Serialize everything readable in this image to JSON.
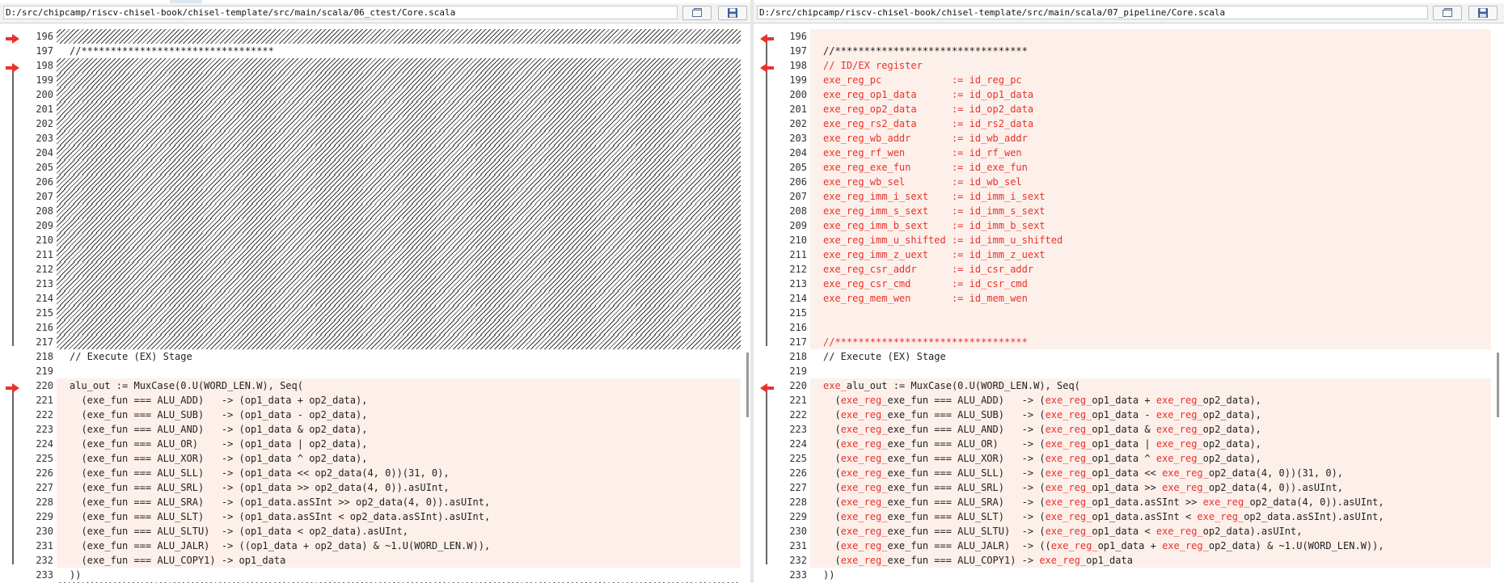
{
  "left": {
    "path": "D:/src/chipcamp/riscv-chisel-book/chisel-template/src/main/scala/06_ctest/Core.scala",
    "lines": [
      {
        "num": "196",
        "text": "",
        "state": "hatch",
        "marker": true
      },
      {
        "num": "197",
        "text": "//*********************************",
        "state": "plain",
        "marker": false
      },
      {
        "num": "198",
        "text": "",
        "state": "hatch",
        "marker": true
      },
      {
        "num": "199",
        "text": "",
        "state": "hatch",
        "marker": false
      },
      {
        "num": "200",
        "text": "",
        "state": "hatch",
        "marker": false
      },
      {
        "num": "201",
        "text": "",
        "state": "hatch",
        "marker": false
      },
      {
        "num": "202",
        "text": "",
        "state": "hatch",
        "marker": false
      },
      {
        "num": "203",
        "text": "",
        "state": "hatch",
        "marker": false
      },
      {
        "num": "204",
        "text": "",
        "state": "hatch",
        "marker": false
      },
      {
        "num": "205",
        "text": "",
        "state": "hatch",
        "marker": false
      },
      {
        "num": "206",
        "text": "",
        "state": "hatch",
        "marker": false
      },
      {
        "num": "207",
        "text": "",
        "state": "hatch",
        "marker": false
      },
      {
        "num": "208",
        "text": "",
        "state": "hatch",
        "marker": false
      },
      {
        "num": "209",
        "text": "",
        "state": "hatch",
        "marker": false
      },
      {
        "num": "210",
        "text": "",
        "state": "hatch",
        "marker": false
      },
      {
        "num": "211",
        "text": "",
        "state": "hatch",
        "marker": false
      },
      {
        "num": "212",
        "text": "",
        "state": "hatch",
        "marker": false
      },
      {
        "num": "213",
        "text": "",
        "state": "hatch",
        "marker": false
      },
      {
        "num": "214",
        "text": "",
        "state": "hatch",
        "marker": false
      },
      {
        "num": "215",
        "text": "",
        "state": "hatch",
        "marker": false
      },
      {
        "num": "216",
        "text": "",
        "state": "hatch",
        "marker": false
      },
      {
        "num": "217",
        "text": "",
        "state": "hatch",
        "marker": false
      },
      {
        "num": "218",
        "text": "// Execute (EX) Stage",
        "state": "plain",
        "marker": false
      },
      {
        "num": "219",
        "text": "",
        "state": "plain",
        "marker": false
      },
      {
        "num": "220",
        "text": "alu_out := MuxCase(0.U(WORD_LEN.W), Seq(",
        "state": "changed",
        "marker": true
      },
      {
        "num": "221",
        "text": "  (exe_fun === ALU_ADD)   -> (op1_data + op2_data),",
        "state": "changed",
        "marker": false
      },
      {
        "num": "222",
        "text": "  (exe_fun === ALU_SUB)   -> (op1_data - op2_data),",
        "state": "changed",
        "marker": false
      },
      {
        "num": "223",
        "text": "  (exe_fun === ALU_AND)   -> (op1_data & op2_data),",
        "state": "changed",
        "marker": false
      },
      {
        "num": "224",
        "text": "  (exe_fun === ALU_OR)    -> (op1_data | op2_data),",
        "state": "changed",
        "marker": false
      },
      {
        "num": "225",
        "text": "  (exe_fun === ALU_XOR)   -> (op1_data ^ op2_data),",
        "state": "changed",
        "marker": false
      },
      {
        "num": "226",
        "text": "  (exe_fun === ALU_SLL)   -> (op1_data << op2_data(4, 0))(31, 0),",
        "state": "changed",
        "marker": false
      },
      {
        "num": "227",
        "text": "  (exe_fun === ALU_SRL)   -> (op1_data >> op2_data(4, 0)).asUInt,",
        "state": "changed",
        "marker": false
      },
      {
        "num": "228",
        "text": "  (exe_fun === ALU_SRA)   -> (op1_data.asSInt >> op2_data(4, 0)).asUInt,",
        "state": "changed",
        "marker": false
      },
      {
        "num": "229",
        "text": "  (exe_fun === ALU_SLT)   -> (op1_data.asSInt < op2_data.asSInt).asUInt,",
        "state": "changed",
        "marker": false
      },
      {
        "num": "230",
        "text": "  (exe_fun === ALU_SLTU)  -> (op1_data < op2_data).asUInt,",
        "state": "changed",
        "marker": false
      },
      {
        "num": "231",
        "text": "  (exe_fun === ALU_JALR)  -> ((op1_data + op2_data) & ~1.U(WORD_LEN.W)),",
        "state": "changed",
        "marker": false
      },
      {
        "num": "232",
        "text": "  (exe_fun === ALU_COPY1) -> op1_data",
        "state": "changed",
        "marker": false
      },
      {
        "num": "233",
        "text": "))",
        "state": "plain",
        "marker": false
      }
    ]
  },
  "right": {
    "path": "D:/src/chipcamp/riscv-chisel-book/chisel-template/src/main/scala/07_pipeline/Core.scala",
    "lines": [
      {
        "num": "196",
        "marker": true,
        "state": "changed",
        "segs": []
      },
      {
        "num": "197",
        "marker": false,
        "state": "changed",
        "segs": [
          {
            "t": "//*********************************",
            "r": false
          }
        ]
      },
      {
        "num": "198",
        "marker": true,
        "state": "changed",
        "segs": [
          {
            "t": "// ID/EX register",
            "r": true
          }
        ]
      },
      {
        "num": "199",
        "marker": false,
        "state": "changed",
        "segs": [
          {
            "t": "exe_reg_pc            := id_reg_pc",
            "r": true
          }
        ]
      },
      {
        "num": "200",
        "marker": false,
        "state": "changed",
        "segs": [
          {
            "t": "exe_reg_op1_data      := id_op1_data",
            "r": true
          }
        ]
      },
      {
        "num": "201",
        "marker": false,
        "state": "changed",
        "segs": [
          {
            "t": "exe_reg_op2_data      := id_op2_data",
            "r": true
          }
        ]
      },
      {
        "num": "202",
        "marker": false,
        "state": "changed",
        "segs": [
          {
            "t": "exe_reg_rs2_data      := id_rs2_data",
            "r": true
          }
        ]
      },
      {
        "num": "203",
        "marker": false,
        "state": "changed",
        "segs": [
          {
            "t": "exe_reg_wb_addr       := id_wb_addr",
            "r": true
          }
        ]
      },
      {
        "num": "204",
        "marker": false,
        "state": "changed",
        "segs": [
          {
            "t": "exe_reg_rf_wen        := id_rf_wen",
            "r": true
          }
        ]
      },
      {
        "num": "205",
        "marker": false,
        "state": "changed",
        "segs": [
          {
            "t": "exe_reg_exe_fun       := id_exe_fun",
            "r": true
          }
        ]
      },
      {
        "num": "206",
        "marker": false,
        "state": "changed",
        "segs": [
          {
            "t": "exe_reg_wb_sel        := id_wb_sel",
            "r": true
          }
        ]
      },
      {
        "num": "207",
        "marker": false,
        "state": "changed",
        "segs": [
          {
            "t": "exe_reg_imm_i_sext    := id_imm_i_sext",
            "r": true
          }
        ]
      },
      {
        "num": "208",
        "marker": false,
        "state": "changed",
        "segs": [
          {
            "t": "exe_reg_imm_s_sext    := id_imm_s_sext",
            "r": true
          }
        ]
      },
      {
        "num": "209",
        "marker": false,
        "state": "changed",
        "segs": [
          {
            "t": "exe_reg_imm_b_sext    := id_imm_b_sext",
            "r": true
          }
        ]
      },
      {
        "num": "210",
        "marker": false,
        "state": "changed",
        "segs": [
          {
            "t": "exe_reg_imm_u_shifted := id_imm_u_shifted",
            "r": true
          }
        ]
      },
      {
        "num": "211",
        "marker": false,
        "state": "changed",
        "segs": [
          {
            "t": "exe_reg_imm_z_uext    := id_imm_z_uext",
            "r": true
          }
        ]
      },
      {
        "num": "212",
        "marker": false,
        "state": "changed",
        "segs": [
          {
            "t": "exe_reg_csr_addr      := id_csr_addr",
            "r": true
          }
        ]
      },
      {
        "num": "213",
        "marker": false,
        "state": "changed",
        "segs": [
          {
            "t": "exe_reg_csr_cmd       := id_csr_cmd",
            "r": true
          }
        ]
      },
      {
        "num": "214",
        "marker": false,
        "state": "changed",
        "segs": [
          {
            "t": "exe_reg_mem_wen       := id_mem_wen",
            "r": true
          }
        ]
      },
      {
        "num": "215",
        "marker": false,
        "state": "changed",
        "segs": []
      },
      {
        "num": "216",
        "marker": false,
        "state": "changed",
        "segs": []
      },
      {
        "num": "217",
        "marker": false,
        "state": "changed",
        "segs": [
          {
            "t": "//*********************************",
            "r": true
          }
        ]
      },
      {
        "num": "218",
        "marker": false,
        "state": "plain",
        "segs": [
          {
            "t": "// Execute (EX) Stage",
            "r": false
          }
        ]
      },
      {
        "num": "219",
        "marker": false,
        "state": "plain",
        "segs": []
      },
      {
        "num": "220",
        "marker": true,
        "state": "changed",
        "segs": [
          {
            "t": "exe_",
            "r": true
          },
          {
            "t": "alu_out := MuxCase(0.U(WORD_LEN.W), Seq(",
            "r": false
          }
        ]
      },
      {
        "num": "221",
        "marker": false,
        "state": "changed",
        "segs": [
          {
            "t": "  (",
            "r": false
          },
          {
            "t": "exe_reg_",
            "r": true
          },
          {
            "t": "exe_fun === ALU_ADD)   -> (",
            "r": false
          },
          {
            "t": "exe_reg_",
            "r": true
          },
          {
            "t": "op1_data + ",
            "r": false
          },
          {
            "t": "exe_reg_",
            "r": true
          },
          {
            "t": "op2_data),",
            "r": false
          }
        ]
      },
      {
        "num": "222",
        "marker": false,
        "state": "changed",
        "segs": [
          {
            "t": "  (",
            "r": false
          },
          {
            "t": "exe_reg_",
            "r": true
          },
          {
            "t": "exe_fun === ALU_SUB)   -> (",
            "r": false
          },
          {
            "t": "exe_reg_",
            "r": true
          },
          {
            "t": "op1_data - ",
            "r": false
          },
          {
            "t": "exe_reg_",
            "r": true
          },
          {
            "t": "op2_data),",
            "r": false
          }
        ]
      },
      {
        "num": "223",
        "marker": false,
        "state": "changed",
        "segs": [
          {
            "t": "  (",
            "r": false
          },
          {
            "t": "exe_reg_",
            "r": true
          },
          {
            "t": "exe_fun === ALU_AND)   -> (",
            "r": false
          },
          {
            "t": "exe_reg_",
            "r": true
          },
          {
            "t": "op1_data & ",
            "r": false
          },
          {
            "t": "exe_reg_",
            "r": true
          },
          {
            "t": "op2_data),",
            "r": false
          }
        ]
      },
      {
        "num": "224",
        "marker": false,
        "state": "changed",
        "segs": [
          {
            "t": "  (",
            "r": false
          },
          {
            "t": "exe_reg_",
            "r": true
          },
          {
            "t": "exe_fun === ALU_OR)    -> (",
            "r": false
          },
          {
            "t": "exe_reg_",
            "r": true
          },
          {
            "t": "op1_data | ",
            "r": false
          },
          {
            "t": "exe_reg_",
            "r": true
          },
          {
            "t": "op2_data),",
            "r": false
          }
        ]
      },
      {
        "num": "225",
        "marker": false,
        "state": "changed",
        "segs": [
          {
            "t": "  (",
            "r": false
          },
          {
            "t": "exe_reg_",
            "r": true
          },
          {
            "t": "exe_fun === ALU_XOR)   -> (",
            "r": false
          },
          {
            "t": "exe_reg_",
            "r": true
          },
          {
            "t": "op1_data ^ ",
            "r": false
          },
          {
            "t": "exe_reg_",
            "r": true
          },
          {
            "t": "op2_data),",
            "r": false
          }
        ]
      },
      {
        "num": "226",
        "marker": false,
        "state": "changed",
        "segs": [
          {
            "t": "  (",
            "r": false
          },
          {
            "t": "exe_reg_",
            "r": true
          },
          {
            "t": "exe_fun === ALU_SLL)   -> (",
            "r": false
          },
          {
            "t": "exe_reg_",
            "r": true
          },
          {
            "t": "op1_data << ",
            "r": false
          },
          {
            "t": "exe_reg_",
            "r": true
          },
          {
            "t": "op2_data(4, 0))(31, 0),",
            "r": false
          }
        ]
      },
      {
        "num": "227",
        "marker": false,
        "state": "changed",
        "segs": [
          {
            "t": "  (",
            "r": false
          },
          {
            "t": "exe_reg_",
            "r": true
          },
          {
            "t": "exe_fun === ALU_SRL)   -> (",
            "r": false
          },
          {
            "t": "exe_reg_",
            "r": true
          },
          {
            "t": "op1_data >> ",
            "r": false
          },
          {
            "t": "exe_reg_",
            "r": true
          },
          {
            "t": "op2_data(4, 0)).asUInt,",
            "r": false
          }
        ]
      },
      {
        "num": "228",
        "marker": false,
        "state": "changed",
        "segs": [
          {
            "t": "  (",
            "r": false
          },
          {
            "t": "exe_reg_",
            "r": true
          },
          {
            "t": "exe_fun === ALU_SRA)   -> (",
            "r": false
          },
          {
            "t": "exe_reg_",
            "r": true
          },
          {
            "t": "op1_data.asSInt >> ",
            "r": false
          },
          {
            "t": "exe_reg_",
            "r": true
          },
          {
            "t": "op2_data(4, 0)).asUInt,",
            "r": false
          }
        ]
      },
      {
        "num": "229",
        "marker": false,
        "state": "changed",
        "segs": [
          {
            "t": "  (",
            "r": false
          },
          {
            "t": "exe_reg_",
            "r": true
          },
          {
            "t": "exe_fun === ALU_SLT)   -> (",
            "r": false
          },
          {
            "t": "exe_reg_",
            "r": true
          },
          {
            "t": "op1_data.asSInt < ",
            "r": false
          },
          {
            "t": "exe_reg_",
            "r": true
          },
          {
            "t": "op2_data.asSInt).asUInt,",
            "r": false
          }
        ]
      },
      {
        "num": "230",
        "marker": false,
        "state": "changed",
        "segs": [
          {
            "t": "  (",
            "r": false
          },
          {
            "t": "exe_reg_",
            "r": true
          },
          {
            "t": "exe_fun === ALU_SLTU)  -> (",
            "r": false
          },
          {
            "t": "exe_reg_",
            "r": true
          },
          {
            "t": "op1_data < ",
            "r": false
          },
          {
            "t": "exe_reg_",
            "r": true
          },
          {
            "t": "op2_data).asUInt,",
            "r": false
          }
        ]
      },
      {
        "num": "231",
        "marker": false,
        "state": "changed",
        "segs": [
          {
            "t": "  (",
            "r": false
          },
          {
            "t": "exe_reg_",
            "r": true
          },
          {
            "t": "exe_fun === ALU_JALR)  -> ((",
            "r": false
          },
          {
            "t": "exe_reg_",
            "r": true
          },
          {
            "t": "op1_data + ",
            "r": false
          },
          {
            "t": "exe_reg_",
            "r": true
          },
          {
            "t": "op2_data) & ~1.U(WORD_LEN.W)),",
            "r": false
          }
        ]
      },
      {
        "num": "232",
        "marker": false,
        "state": "changed",
        "segs": [
          {
            "t": "  (",
            "r": false
          },
          {
            "t": "exe_reg_",
            "r": true
          },
          {
            "t": "exe_fun === ALU_COPY1) -> ",
            "r": false
          },
          {
            "t": "exe_reg_",
            "r": true
          },
          {
            "t": "op1_data",
            "r": false
          }
        ]
      },
      {
        "num": "233",
        "marker": false,
        "state": "plain",
        "segs": [
          {
            "t": "))",
            "r": false
          }
        ]
      }
    ]
  },
  "icons": {
    "copy_path": "copy-icon",
    "save": "save-icon",
    "diff_marker": "red-arrow-icon"
  },
  "colors": {
    "changed_bg": "#fdf0ea",
    "changed_text": "#e8322d",
    "marker": "#e8322d",
    "hatch": "#3a3a3a"
  }
}
